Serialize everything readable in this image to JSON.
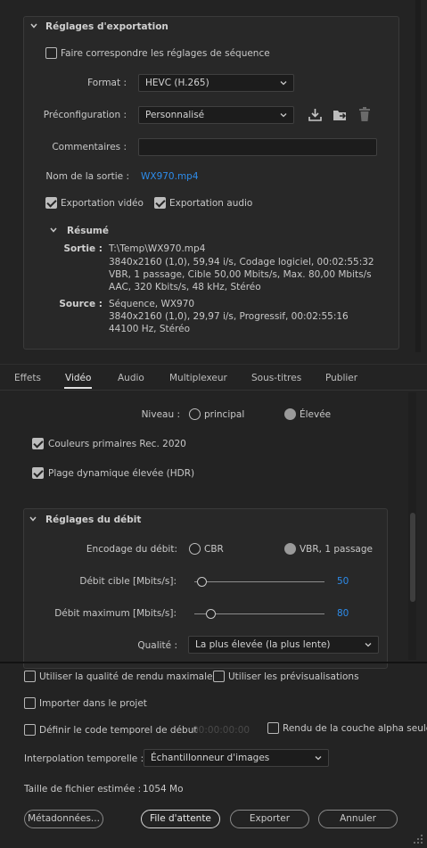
{
  "export_settings": {
    "title": "Réglages d'exportation",
    "match_sequence_label": "Faire correspondre les réglages de séquence",
    "format_label": "Format :",
    "format_value": "HEVC (H.265)",
    "preset_label": "Préconfiguration :",
    "preset_value": "Personnalisé",
    "comments_label": "Commentaires :",
    "comments_value": "",
    "output_name_label": "Nom de la sortie :",
    "output_name_value": "WX970.mp4",
    "export_video_label": "Exportation vidéo",
    "export_audio_label": "Exportation audio",
    "export_video_checked": true,
    "export_audio_checked": true,
    "match_sequence_checked": false,
    "icons": [
      "save-preset-icon",
      "import-preset-icon",
      "delete-preset-icon"
    ]
  },
  "summary": {
    "title": "Résumé",
    "output_label": "Sortie :",
    "output_lines": [
      "T:\\Temp\\WX970.mp4",
      "3840x2160 (1,0), 59,94 i/s, Codage logiciel, 00:02:55:32",
      "VBR, 1 passage, Cible 50,00  Mbits/s, Max. 80,00  Mbits/s",
      "AAC, 320  Kbits/s, 48  kHz, Stéréo"
    ],
    "source_label": "Source :",
    "source_lines": [
      "Séquence, WX970",
      "3840x2160 (1,0), 29,97  i/s, Progressif, 00:02:55:16",
      "44100 Hz, Stéréo"
    ]
  },
  "tabs": [
    {
      "label": "Effets",
      "active": false
    },
    {
      "label": "Vidéo",
      "active": true
    },
    {
      "label": "Audio",
      "active": false
    },
    {
      "label": "Multiplexeur",
      "active": false
    },
    {
      "label": "Sous-titres",
      "active": false
    },
    {
      "label": "Publier",
      "active": false
    }
  ],
  "video": {
    "level_label": "Niveau :",
    "level_options": [
      "principal",
      "Élevée"
    ],
    "level_selected": "Élevée",
    "rec2020_label": "Couleurs primaires Rec. 2020",
    "rec2020_checked": true,
    "hdr_label": "Plage dynamique élevée (HDR)",
    "hdr_checked": true
  },
  "bitrate": {
    "title": "Réglages du débit",
    "encoding_label": "Encodage du débit:",
    "encoding_options": [
      "CBR",
      "VBR, 1 passage"
    ],
    "encoding_selected": "VBR, 1 passage",
    "target_label": "Débit cible [Mbits/s]:",
    "target_value": "50",
    "target_fraction": 0.06,
    "max_label": "Débit maximum [Mbits/s]:",
    "max_value": "80",
    "max_fraction": 0.13,
    "quality_label": "Qualité :",
    "quality_value": "La plus élevée (la plus lente)"
  },
  "bottom": {
    "max_render_quality_label": "Utiliser la qualité de rendu maximale",
    "use_previews_label": "Utiliser les prévisualisations",
    "import_project_label": "Importer dans le projet",
    "set_start_timecode_label": "Définir le code temporel de début",
    "start_timecode_value": "00:00:00:00",
    "alpha_only_label": "Rendu de la couche alpha seule",
    "time_interpolation_label": "Interpolation temporelle :",
    "time_interpolation_value": "Échantillonneur d'images",
    "file_size_label": "Taille de fichier estimée :",
    "file_size_value": "1054 Mo"
  },
  "buttons": {
    "metadata": "Métadonnées...",
    "queue": "File d'attente",
    "export": "Exporter",
    "cancel": "Annuler"
  },
  "colors": {
    "background": "#232323",
    "accent_blue": "#2d8ceb",
    "text": "#c8c8c8"
  }
}
